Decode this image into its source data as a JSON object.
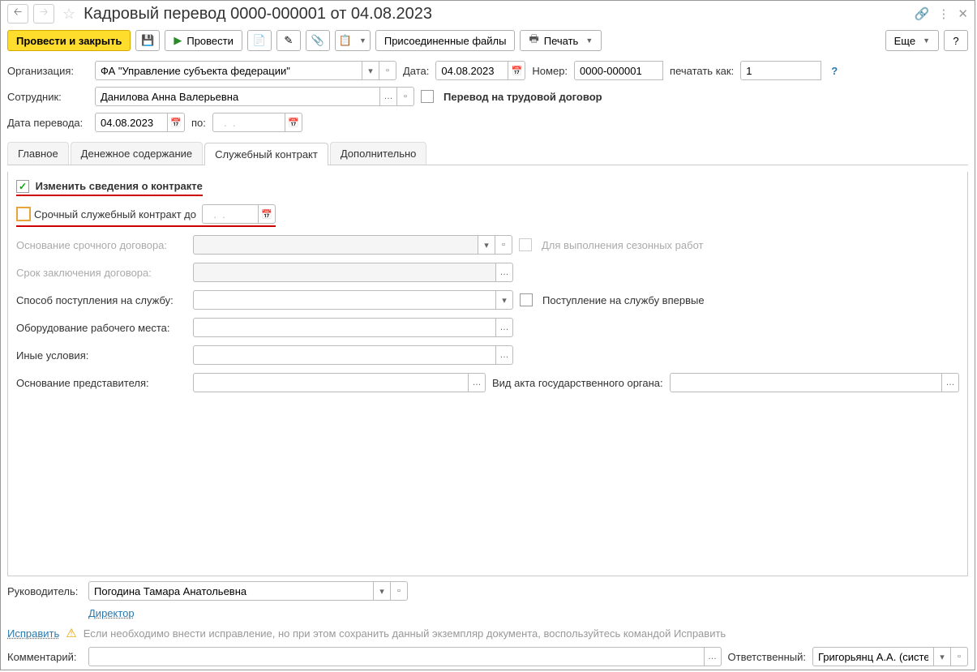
{
  "title": "Кадровый перевод 0000-000001 от 04.08.2023",
  "toolbar": {
    "post_close": "Провести и закрыть",
    "post": "Провести",
    "attachments": "Присоединенные файлы",
    "print": "Печать",
    "more": "Еще",
    "help": "?"
  },
  "header": {
    "org_label": "Организация:",
    "org_value": "ФА \"Управление субъекта федерации\"",
    "date_label": "Дата:",
    "date_value": "04.08.2023",
    "number_label": "Номер:",
    "number_value": "0000-000001",
    "print_as_label": "печатать как:",
    "print_as_value": "1",
    "employee_label": "Сотрудник:",
    "employee_value": "Данилова Анна Валерьевна",
    "transfer_to_contract": "Перевод на трудовой договор",
    "transfer_date_label": "Дата перевода:",
    "transfer_date_value": "04.08.2023",
    "to_label": "по:",
    "to_placeholder": "  .  .    "
  },
  "tabs": {
    "main": "Главное",
    "salary": "Денежное содержание",
    "contract": "Служебный контракт",
    "extra": "Дополнительно"
  },
  "contract": {
    "edit_contract": "Изменить сведения о контракте",
    "urgent_label": "Срочный служебный контракт до",
    "urgent_placeholder": "  .  .    ",
    "basis_label": "Основание срочного договора:",
    "seasonal": "Для выполнения сезонных работ",
    "term_label": "Срок заключения договора:",
    "entry_label": "Способ поступления на службу:",
    "first_time": "Поступление на службу впервые",
    "equipment_label": "Оборудование рабочего места:",
    "other_label": "Иные условия:",
    "rep_basis_label": "Основание представителя:",
    "act_type_label": "Вид акта государственного органа:"
  },
  "footer": {
    "supervisor_label": "Руководитель:",
    "supervisor_value": "Погодина Тамара Анатольевна",
    "position": "Директор",
    "fix": "Исправить",
    "note": "Если необходимо внести исправление, но при этом сохранить данный экземпляр документа, воспользуйтесь командой Исправить",
    "comment_label": "Комментарий:",
    "responsible_label": "Ответственный:",
    "responsible_value": "Григорьянц А.А. (системн"
  }
}
